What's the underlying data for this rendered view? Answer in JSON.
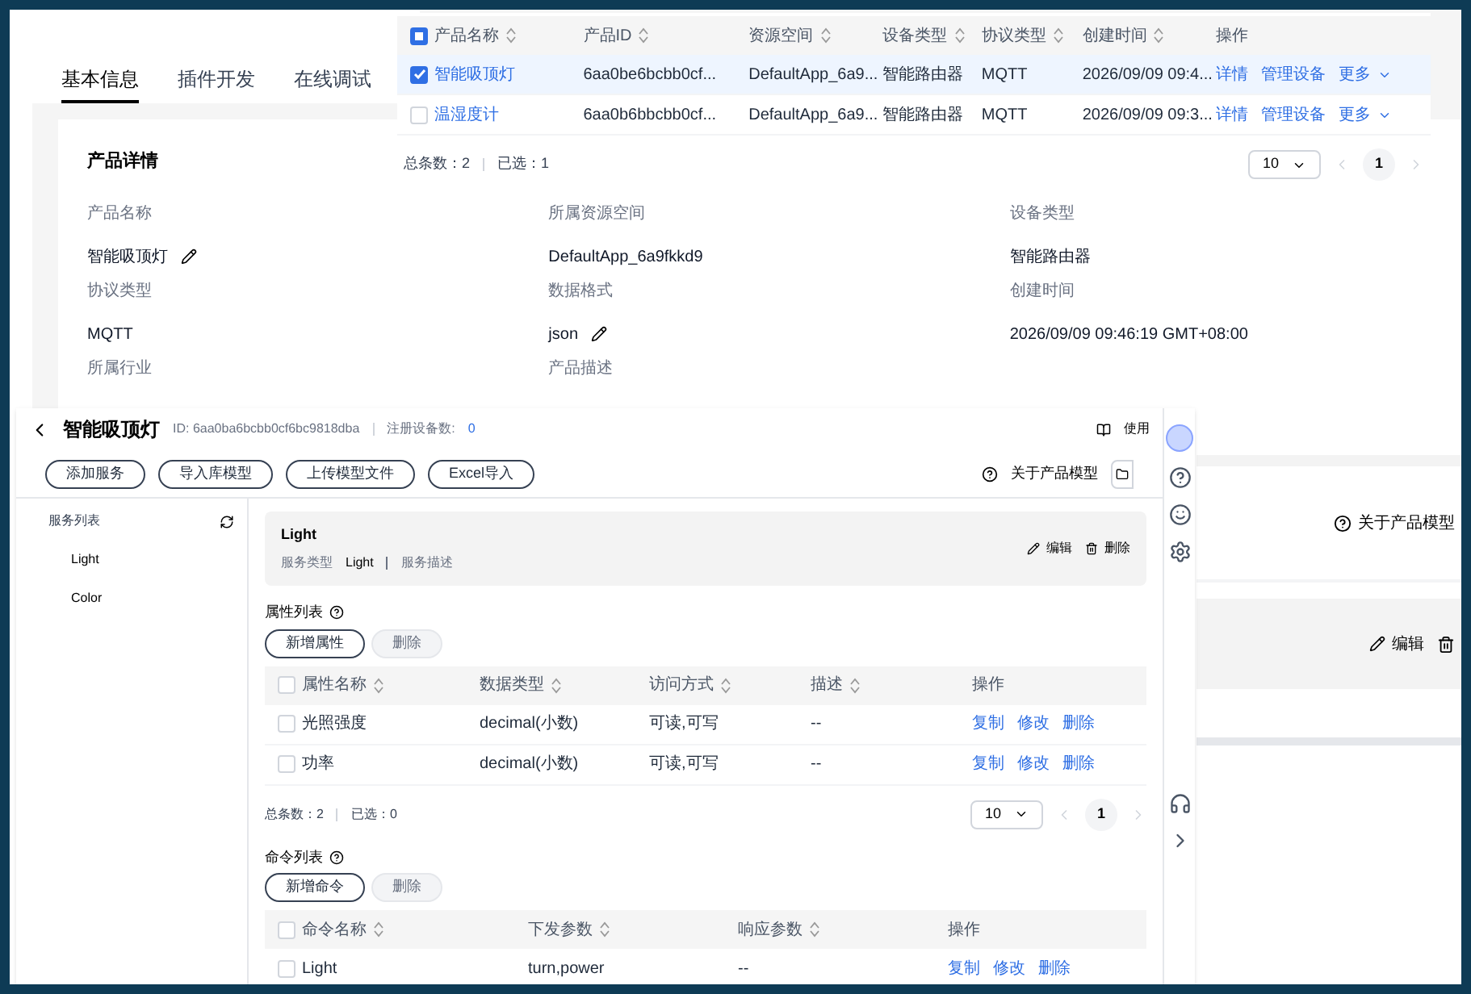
{
  "top_page": {
    "tabs": [
      {
        "label": "基本信息",
        "selected": true
      },
      {
        "label": "插件开发",
        "selected": false
      },
      {
        "label": "在线调试",
        "selected": false
      }
    ],
    "card": {
      "title": "产品详情",
      "fields": [
        {
          "label": "产品名称",
          "value": "智能吸顶灯",
          "editable": true
        },
        {
          "label": "所属资源空间",
          "value": "DefaultApp_6a9fkkd9"
        },
        {
          "label": "设备类型",
          "value": "智能路由器"
        },
        {
          "label": "协议类型",
          "value": "MQTT"
        },
        {
          "label": "数据格式",
          "value": "json",
          "editable": true
        },
        {
          "label": "创建时间",
          "value": "2026/09/09 09:46:19 GMT+08:00"
        },
        {
          "label": "所属行业"
        },
        {
          "label": "产品描述"
        }
      ]
    }
  },
  "product_table": {
    "header_indeterminate": true,
    "columns": [
      {
        "label": "产品名称",
        "sortable": true
      },
      {
        "label": "产品ID",
        "sortable": true
      },
      {
        "label": "资源空间",
        "sortable": true
      },
      {
        "label": "设备类型",
        "sortable": true
      },
      {
        "label": "协议类型",
        "sortable": true
      },
      {
        "label": "创建时间",
        "sortable": true
      },
      {
        "label": "操作"
      }
    ],
    "rows": [
      {
        "selected": true,
        "cells": [
          "智能吸顶灯",
          "6aa0be6bcbb0cf...",
          "DefaultApp_6a9...",
          "智能路由器",
          "MQTT",
          "2026/09/09 09:4..."
        ],
        "actions": [
          "详情",
          "管理设备",
          "更多"
        ]
      },
      {
        "selected": false,
        "cells": [
          "温湿度计",
          "6aa0b6bbcbb0cf...",
          "DefaultApp_6a9...",
          "智能路由器",
          "MQTT",
          "2026/09/09 09:3..."
        ],
        "actions": [
          "详情",
          "管理设备",
          "更多"
        ]
      }
    ],
    "total": "总条数：2",
    "selected_count": "已选：1",
    "page_size": "10",
    "page": "1"
  },
  "model_page": {
    "title": "智能吸顶灯",
    "id_text": "ID: 6aa0ba6bcbb0cf6bc9818dba",
    "device_count_label": "注册设备数:",
    "device_count": "0",
    "guide": "使用",
    "toolbar": [
      "添加服务",
      "导入库模型",
      "上传模型文件",
      "Excel导入"
    ],
    "about": "关于产品模型",
    "services": {
      "title": "服务列表",
      "items": [
        "Light",
        "Color"
      ]
    },
    "service_card": {
      "name": "Light",
      "type_label": "服务类型",
      "type": "Light",
      "desc_label": "服务描述",
      "actions": [
        "编辑",
        "删除"
      ]
    },
    "properties": {
      "title": "属性列表",
      "header_checked": false,
      "buttons": [
        {
          "label": "新增属性",
          "disabled": false
        },
        {
          "label": "删除",
          "disabled": true
        }
      ],
      "columns": [
        {
          "label": "属性名称",
          "sortable": true
        },
        {
          "label": "数据类型",
          "sortable": true
        },
        {
          "label": "访问方式",
          "sortable": true
        },
        {
          "label": "描述",
          "sortable": true
        },
        {
          "label": "操作"
        }
      ],
      "rows": [
        {
          "selected": false,
          "cells": [
            "光照强度",
            "decimal(小数)",
            "可读,可写",
            "--"
          ],
          "actions": [
            "复制",
            "修改",
            "删除"
          ]
        },
        {
          "selected": false,
          "cells": [
            "功率",
            "decimal(小数)",
            "可读,可写",
            "--"
          ],
          "actions": [
            "复制",
            "修改",
            "删除"
          ]
        }
      ],
      "total": "总条数：2",
      "selected_count": "已选：0",
      "page_size": "10",
      "page": "1"
    },
    "commands": {
      "title": "命令列表",
      "header_checked": false,
      "buttons": [
        {
          "label": "新增命令",
          "disabled": false
        },
        {
          "label": "删除",
          "disabled": true
        }
      ],
      "columns": [
        {
          "label": "命令名称",
          "sortable": true
        },
        {
          "label": "下发参数",
          "sortable": true
        },
        {
          "label": "响应参数",
          "sortable": true
        },
        {
          "label": "操作"
        }
      ],
      "rows": [
        {
          "selected": false,
          "cells": [
            "Light",
            "turn,power",
            "--"
          ],
          "actions": [
            "复制",
            "修改",
            "删除"
          ]
        }
      ]
    }
  },
  "side_fragment": {
    "about": "关于产品模型",
    "actions": [
      "编辑"
    ]
  }
}
